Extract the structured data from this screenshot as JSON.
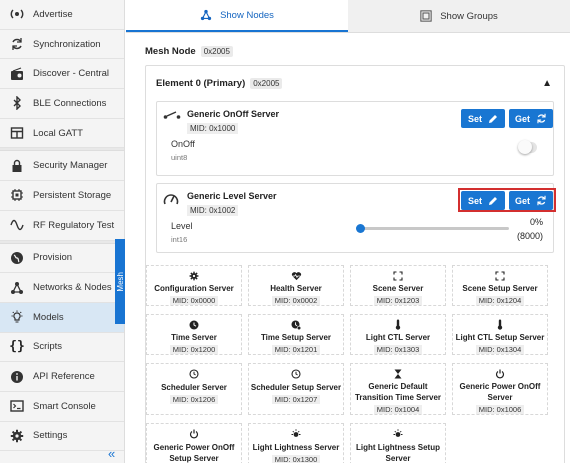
{
  "sidebar": {
    "items": [
      {
        "label": "Advertise",
        "icon": "broadcast-icon"
      },
      {
        "label": "Synchronization",
        "icon": "sync-icon"
      },
      {
        "label": "Discover - Central",
        "icon": "radio-icon"
      },
      {
        "label": "BLE Connections",
        "icon": "bluetooth-icon"
      },
      {
        "label": "Local GATT",
        "icon": "table-icon"
      },
      {
        "label": "Security Manager",
        "icon": "lock-icon"
      },
      {
        "label": "Persistent Storage",
        "icon": "chip-icon"
      },
      {
        "label": "RF Regulatory Test",
        "icon": "wave-icon"
      },
      {
        "label": "Provision",
        "icon": "globe-icon"
      },
      {
        "label": "Networks & Nodes",
        "icon": "network-icon"
      },
      {
        "label": "Models",
        "icon": "bulb-icon"
      },
      {
        "label": "Scripts",
        "icon": "braces-icon"
      },
      {
        "label": "API Reference",
        "icon": "info-icon"
      },
      {
        "label": "Smart Console",
        "icon": "console-icon"
      },
      {
        "label": "Settings",
        "icon": "gear-icon"
      }
    ],
    "mesh_tab": "Mesh",
    "collapse": "«"
  },
  "tabs": [
    {
      "label": "Show Nodes",
      "active": true
    },
    {
      "label": "Show Groups",
      "active": false
    }
  ],
  "mesh_node": {
    "label": "Mesh Node",
    "address": "0x2005"
  },
  "element": {
    "label": "Element 0 (Primary)",
    "address": "0x2005"
  },
  "models": [
    {
      "title": "Generic OnOff Server",
      "mid": "MID: 0x1000",
      "state": "OnOff",
      "type": "uint8"
    },
    {
      "title": "Generic Level Server",
      "mid": "MID: 0x1002",
      "state": "Level",
      "type": "int16",
      "percent": "0%",
      "value": "(8000)"
    }
  ],
  "buttons": {
    "set": "Set",
    "get": "Get"
  },
  "colors": {
    "accent": "#1976d2",
    "highlight": "#d32f2f",
    "active_sidebar": "#d8e7f4"
  },
  "servers": [
    {
      "name": "Configuration Server",
      "mid": "MID: 0x0000",
      "icon": "gear-icon"
    },
    {
      "name": "Health Server",
      "mid": "MID: 0x0002",
      "icon": "heart-pulse-icon"
    },
    {
      "name": "Scene Server",
      "mid": "MID: 0x1203",
      "icon": "scene-icon"
    },
    {
      "name": "Scene Setup Server",
      "mid": "MID: 0x1204",
      "icon": "scene-icon"
    },
    {
      "name": "Time Server",
      "mid": "MID: 0x1200",
      "icon": "clock-icon"
    },
    {
      "name": "Time Setup Server",
      "mid": "MID: 0x1201",
      "icon": "clock-gear-icon"
    },
    {
      "name": "Light CTL Server",
      "mid": "MID: 0x1303",
      "icon": "thermometer-icon"
    },
    {
      "name": "Light CTL Setup Server",
      "mid": "MID: 0x1304",
      "icon": "thermometer-icon"
    },
    {
      "name": "Scheduler Server",
      "mid": "MID: 0x1206",
      "icon": "schedule-icon"
    },
    {
      "name": "Scheduler Setup Server",
      "mid": "MID: 0x1207",
      "icon": "schedule-icon"
    },
    {
      "name": "Generic Default Transition Time Server",
      "mid": "MID: 0x1004",
      "icon": "hourglass-icon"
    },
    {
      "name": "Generic Power OnOff Server",
      "mid": "MID: 0x1006",
      "icon": "power-icon"
    },
    {
      "name": "Generic Power OnOff Setup Server",
      "mid": "",
      "icon": "power-icon"
    },
    {
      "name": "Light Lightness Server",
      "mid": "MID: 0x1300",
      "icon": "light-icon"
    },
    {
      "name": "Light Lightness Setup Server",
      "mid": "",
      "icon": "light-icon"
    }
  ]
}
